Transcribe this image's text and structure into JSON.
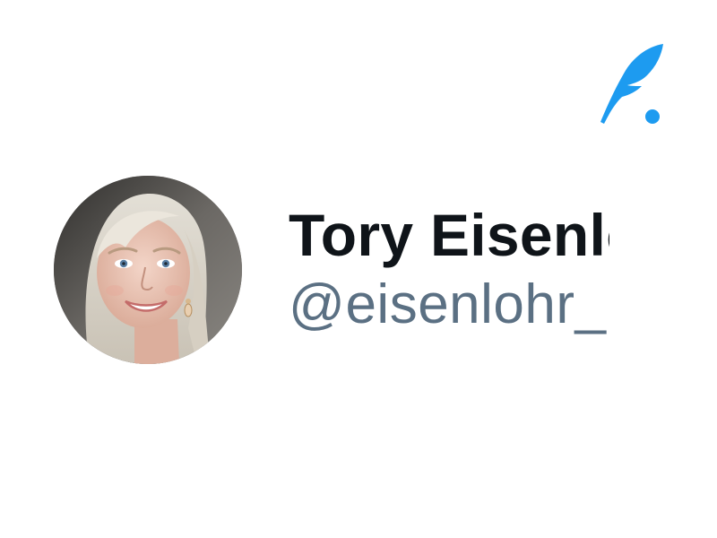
{
  "app": {
    "logo_icon": "quill-feather-icon",
    "logo_color": "#1d9bf0"
  },
  "profile": {
    "avatar_icon": "profile-photo",
    "display_name": "Tory Eisenlohr",
    "handle": "@eisenlohr_"
  },
  "colors": {
    "name_text": "#0f1419",
    "handle_text": "#5b7083",
    "background": "#ffffff"
  }
}
